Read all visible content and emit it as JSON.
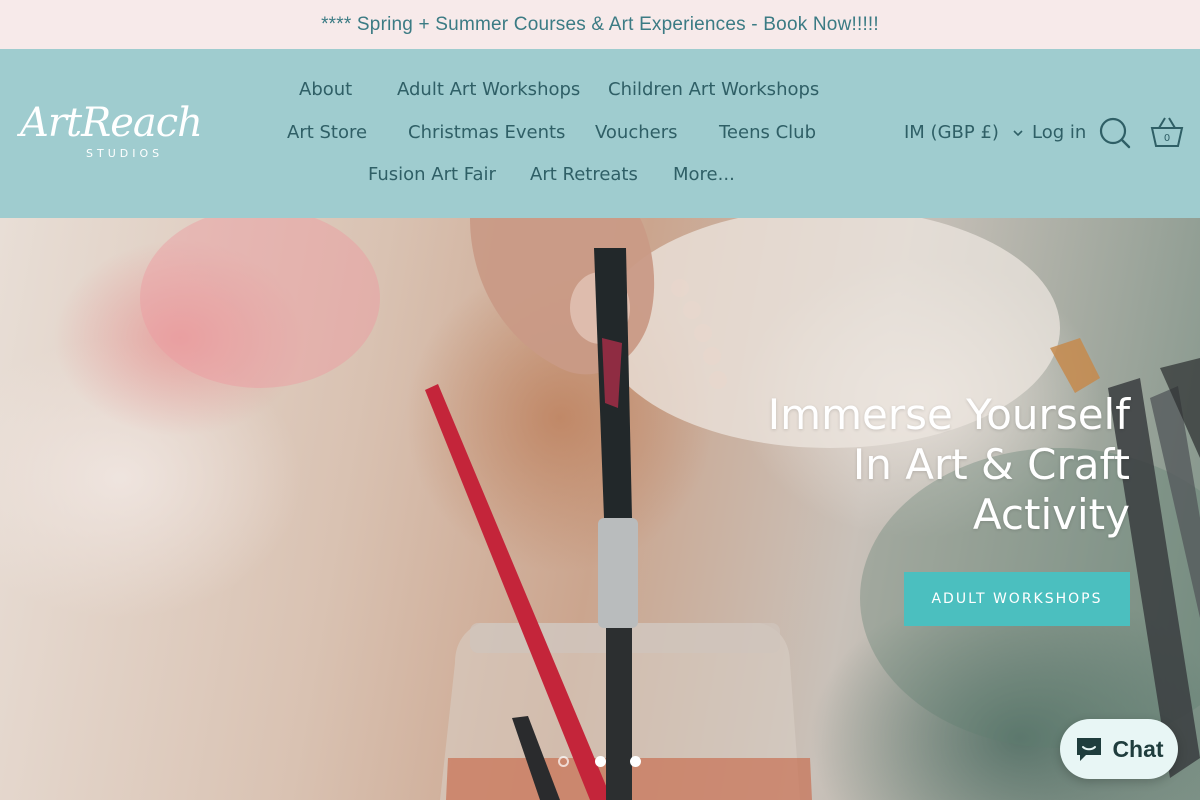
{
  "announcement": {
    "text": "**** Spring + Summer Courses & Art Experiences - Book Now!!!!!"
  },
  "logo": {
    "script": "ArtReach",
    "sub": "STUDIOS"
  },
  "nav": {
    "row1": [
      "About",
      "Adult Art Workshops",
      "Children Art Workshops"
    ],
    "row2": [
      "Art Store",
      "Christmas Events",
      "Vouchers",
      "Teens Club"
    ],
    "row3": [
      "Fusion Art Fair",
      "Art Retreats",
      "More..."
    ]
  },
  "header_right": {
    "currency": "IM (GBP £)",
    "login": "Log in",
    "cart_count": "0"
  },
  "hero": {
    "heading_lines": [
      "Immerse Yourself",
      "In Art & Craft",
      "Activity"
    ],
    "cta_label": "ADULT WORKSHOPS",
    "slides": 3,
    "active_slide": 1
  },
  "chat": {
    "label": "Chat"
  },
  "icons": {
    "search": "search-icon",
    "cart": "basket-icon",
    "chevron": "chevron-down-icon",
    "chat": "chat-bubble-icon"
  },
  "colors": {
    "announcement_bg": "#f7eaea",
    "header_bg": "#9fcccf",
    "nav_text": "#2f5f66",
    "cta_bg": "#4bbfbf",
    "chat_bg": "#e8f6f5"
  }
}
